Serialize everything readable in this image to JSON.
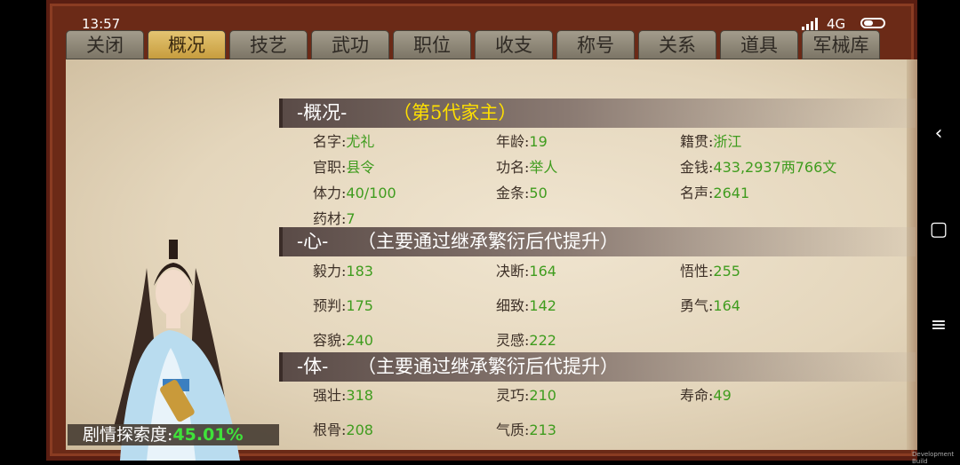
{
  "status": {
    "time": "13:57",
    "network": "4G"
  },
  "tabs": [
    "关闭",
    "概况",
    "技艺",
    "武功",
    "职位",
    "收支",
    "称号",
    "关系",
    "道具",
    "军械库"
  ],
  "active_tab": 1,
  "overview": {
    "title": "-概况-",
    "subtitle": "（第5代家主）",
    "fields": [
      {
        "label": "名字:",
        "value": "尤礼"
      },
      {
        "label": "年龄:",
        "value": "19"
      },
      {
        "label": "籍贯:",
        "value": "浙江"
      },
      {
        "label": "官职:",
        "value": "县令"
      },
      {
        "label": "功名:",
        "value": "举人"
      },
      {
        "label": "金钱:",
        "value": "433,2937两766文"
      },
      {
        "label": "体力:",
        "value": "40/100"
      },
      {
        "label": "金条:",
        "value": "50"
      },
      {
        "label": "名声:",
        "value": "2641"
      },
      {
        "label": "药材:",
        "value": "7"
      }
    ]
  },
  "mind": {
    "title": "-心-",
    "subtitle": "（主要通过继承繁衍后代提升）",
    "fields": [
      {
        "label": "毅力:",
        "value": "183"
      },
      {
        "label": "决断:",
        "value": "164"
      },
      {
        "label": "悟性:",
        "value": "255"
      },
      {
        "label": "预判:",
        "value": "175"
      },
      {
        "label": "细致:",
        "value": "142"
      },
      {
        "label": "勇气:",
        "value": "164"
      },
      {
        "label": "容貌:",
        "value": "240"
      },
      {
        "label": "灵感:",
        "value": "222"
      }
    ]
  },
  "body": {
    "title": "-体-",
    "subtitle": "（主要通过继承繁衍后代提升）",
    "fields": [
      {
        "label": "强壮:",
        "value": "318"
      },
      {
        "label": "灵巧:",
        "value": "210"
      },
      {
        "label": "寿命:",
        "value": "49"
      },
      {
        "label": "根骨:",
        "value": "208"
      },
      {
        "label": "气质:",
        "value": "213"
      }
    ]
  },
  "progress": {
    "label": "剧情探索度:",
    "value": "45.01%"
  },
  "footer": {
    "dev_build": "Development Build"
  },
  "nav": {
    "back": "‹",
    "home": "▢",
    "menu": "≡"
  }
}
